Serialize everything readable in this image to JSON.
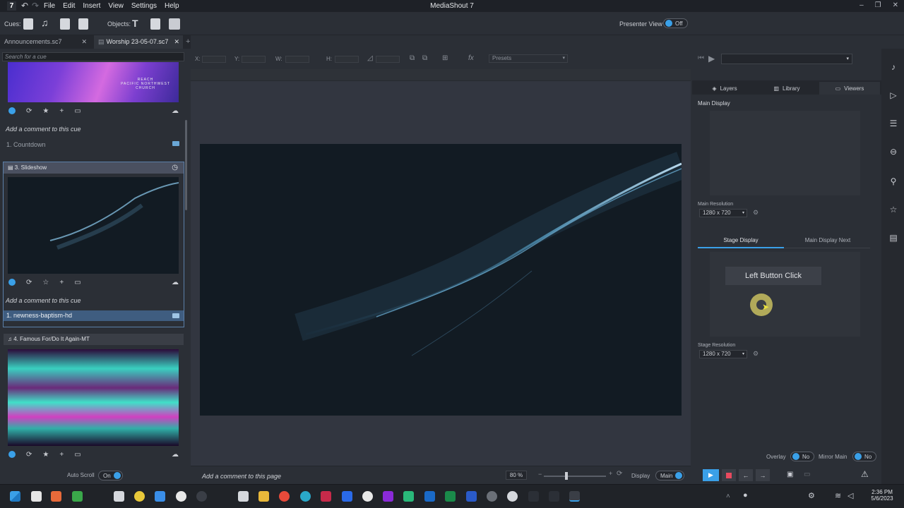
{
  "app": {
    "title": "MediaShout 7",
    "logo": "7",
    "menu": [
      "File",
      "Edit",
      "Insert",
      "View",
      "Settings",
      "Help"
    ],
    "window_controls": [
      "–",
      "❐",
      "✕"
    ]
  },
  "toolbar": {
    "cues_label": "Cues:",
    "objects_label": "Objects:",
    "presenter_view_label": "Presenter View :",
    "presenter_view_value": "Off"
  },
  "tabs": [
    {
      "label": "Announcements.sc7",
      "close": "✕"
    },
    {
      "label": "Worship 23-05-07.sc7",
      "close": "✕"
    }
  ],
  "tab_add": "+",
  "cue_list": {
    "search_placeholder": "Search for a cue",
    "thumb1_text": "REACH\nPACIFIC NORTHWEST\nCHURCH",
    "comment1": "Add a comment to this cue",
    "countdown_item": "1.  Countdown",
    "cue3_header": "3.  Slideshow",
    "comment2": "Add a comment to this cue",
    "cue3_item": "1.  newness-baptism-hd",
    "cue4_header": "4.  Famous For/Do It Again-MT",
    "auto_scroll_label": "Auto Scroll",
    "auto_scroll_value": "On"
  },
  "props": {
    "x": "X:",
    "y": "Y:",
    "w": "W:",
    "h": "H:",
    "fx": "fx",
    "presets": "Presets"
  },
  "bottom": {
    "comment": "Add a comment to this page",
    "zoom": "80 %",
    "display_label": "Display",
    "display_value": "Main"
  },
  "right": {
    "tabs": [
      "Layers",
      "Library",
      "Viewers"
    ],
    "main_display": "Main Display",
    "main_resolution_label": "Main Resolution",
    "main_resolution": "1280 x 720",
    "stage_tabs": [
      "Stage Display",
      "Main Display Next"
    ],
    "tooltip": "Left Button Click",
    "stage_resolution_label": "Stage Resolution",
    "stage_resolution": "1280 x 720",
    "overlay_label": "Overlay",
    "overlay_value": "No",
    "mirror_label": "Mirror Main",
    "mirror_value": "No"
  },
  "taskbar": {
    "time": "2:36 PM",
    "date": "5/6/2023"
  },
  "colors": {
    "accent": "#3aa0e8",
    "stop": "#e84a5f"
  }
}
